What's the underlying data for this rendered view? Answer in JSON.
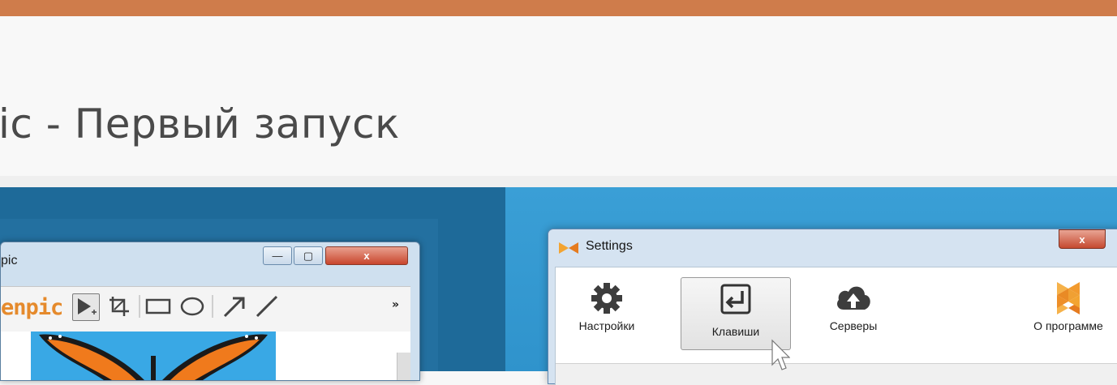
{
  "page": {
    "title": "ic - Первый запуск"
  },
  "left_window": {
    "title": "pic",
    "controls": {
      "minimize": "—",
      "maximize": "▢",
      "close": "x"
    },
    "logo": "enpic",
    "toolbar": {
      "tools": [
        "select-arrow-icon",
        "crop-icon",
        "rectangle-icon",
        "ellipse-icon",
        "arrow-icon",
        "line-icon"
      ],
      "more": "»"
    }
  },
  "right_window": {
    "title": "Settings",
    "close": "x",
    "tabs": [
      {
        "label": "Настройки",
        "icon": "gear-icon"
      },
      {
        "label": "Клавиши",
        "icon": "enter-key-icon"
      },
      {
        "label": "Серверы",
        "icon": "cloud-upload-icon"
      },
      {
        "label": "О программе",
        "icon": "logo-icon"
      }
    ],
    "active_tab": "Клавиши"
  },
  "colors": {
    "accent_orange": "#cf7c4b",
    "panel_dark_blue": "#1e6a99",
    "panel_light_blue": "#3a9fd6",
    "logo_orange": "#e58a2c"
  }
}
